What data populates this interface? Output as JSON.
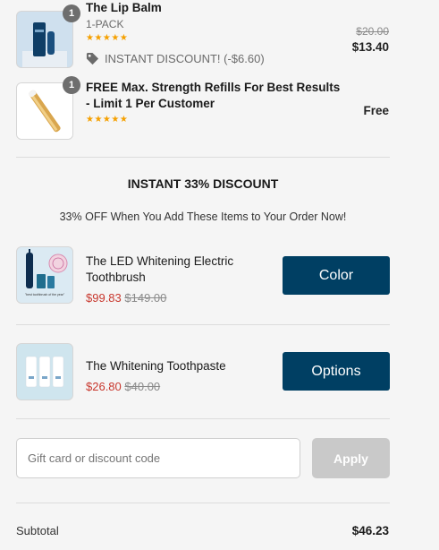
{
  "cart": {
    "items": [
      {
        "quantity": "1",
        "title": "The Lip Balm",
        "variant": "1-PACK",
        "stars": "★★★★★",
        "discount_note": "INSTANT DISCOUNT! (-$6.60)",
        "original_price": "$20.00",
        "price": "$13.40"
      },
      {
        "quantity": "1",
        "title_line1": "FREE Max. Strength Refills For Best Results",
        "title_line2": "- Limit 1 Per Customer",
        "stars": "★★★★★",
        "price": "Free"
      }
    ]
  },
  "upsell": {
    "heading": "INSTANT 33% DISCOUNT",
    "subheading": "33% OFF When You Add These Items to Your Order Now!",
    "products": [
      {
        "title_line1": "The LED Whitening Electric",
        "title_line2": "Toothbrush",
        "sale_price": "$99.83",
        "original_price": "$149.00",
        "button_label": "Color",
        "image_caption": "\"best toothbrush of the year\""
      },
      {
        "title": "The Whitening Toothpaste",
        "sale_price": "$26.80",
        "original_price": "$40.00",
        "button_label": "Options"
      }
    ]
  },
  "discount": {
    "placeholder": "Gift card or discount code",
    "apply_label": "Apply"
  },
  "summary": {
    "subtotal_label": "Subtotal",
    "subtotal_value": "$46.23"
  },
  "colors": {
    "accent": "#003f63",
    "sale": "#c8372d",
    "stars": "#f5a000"
  }
}
